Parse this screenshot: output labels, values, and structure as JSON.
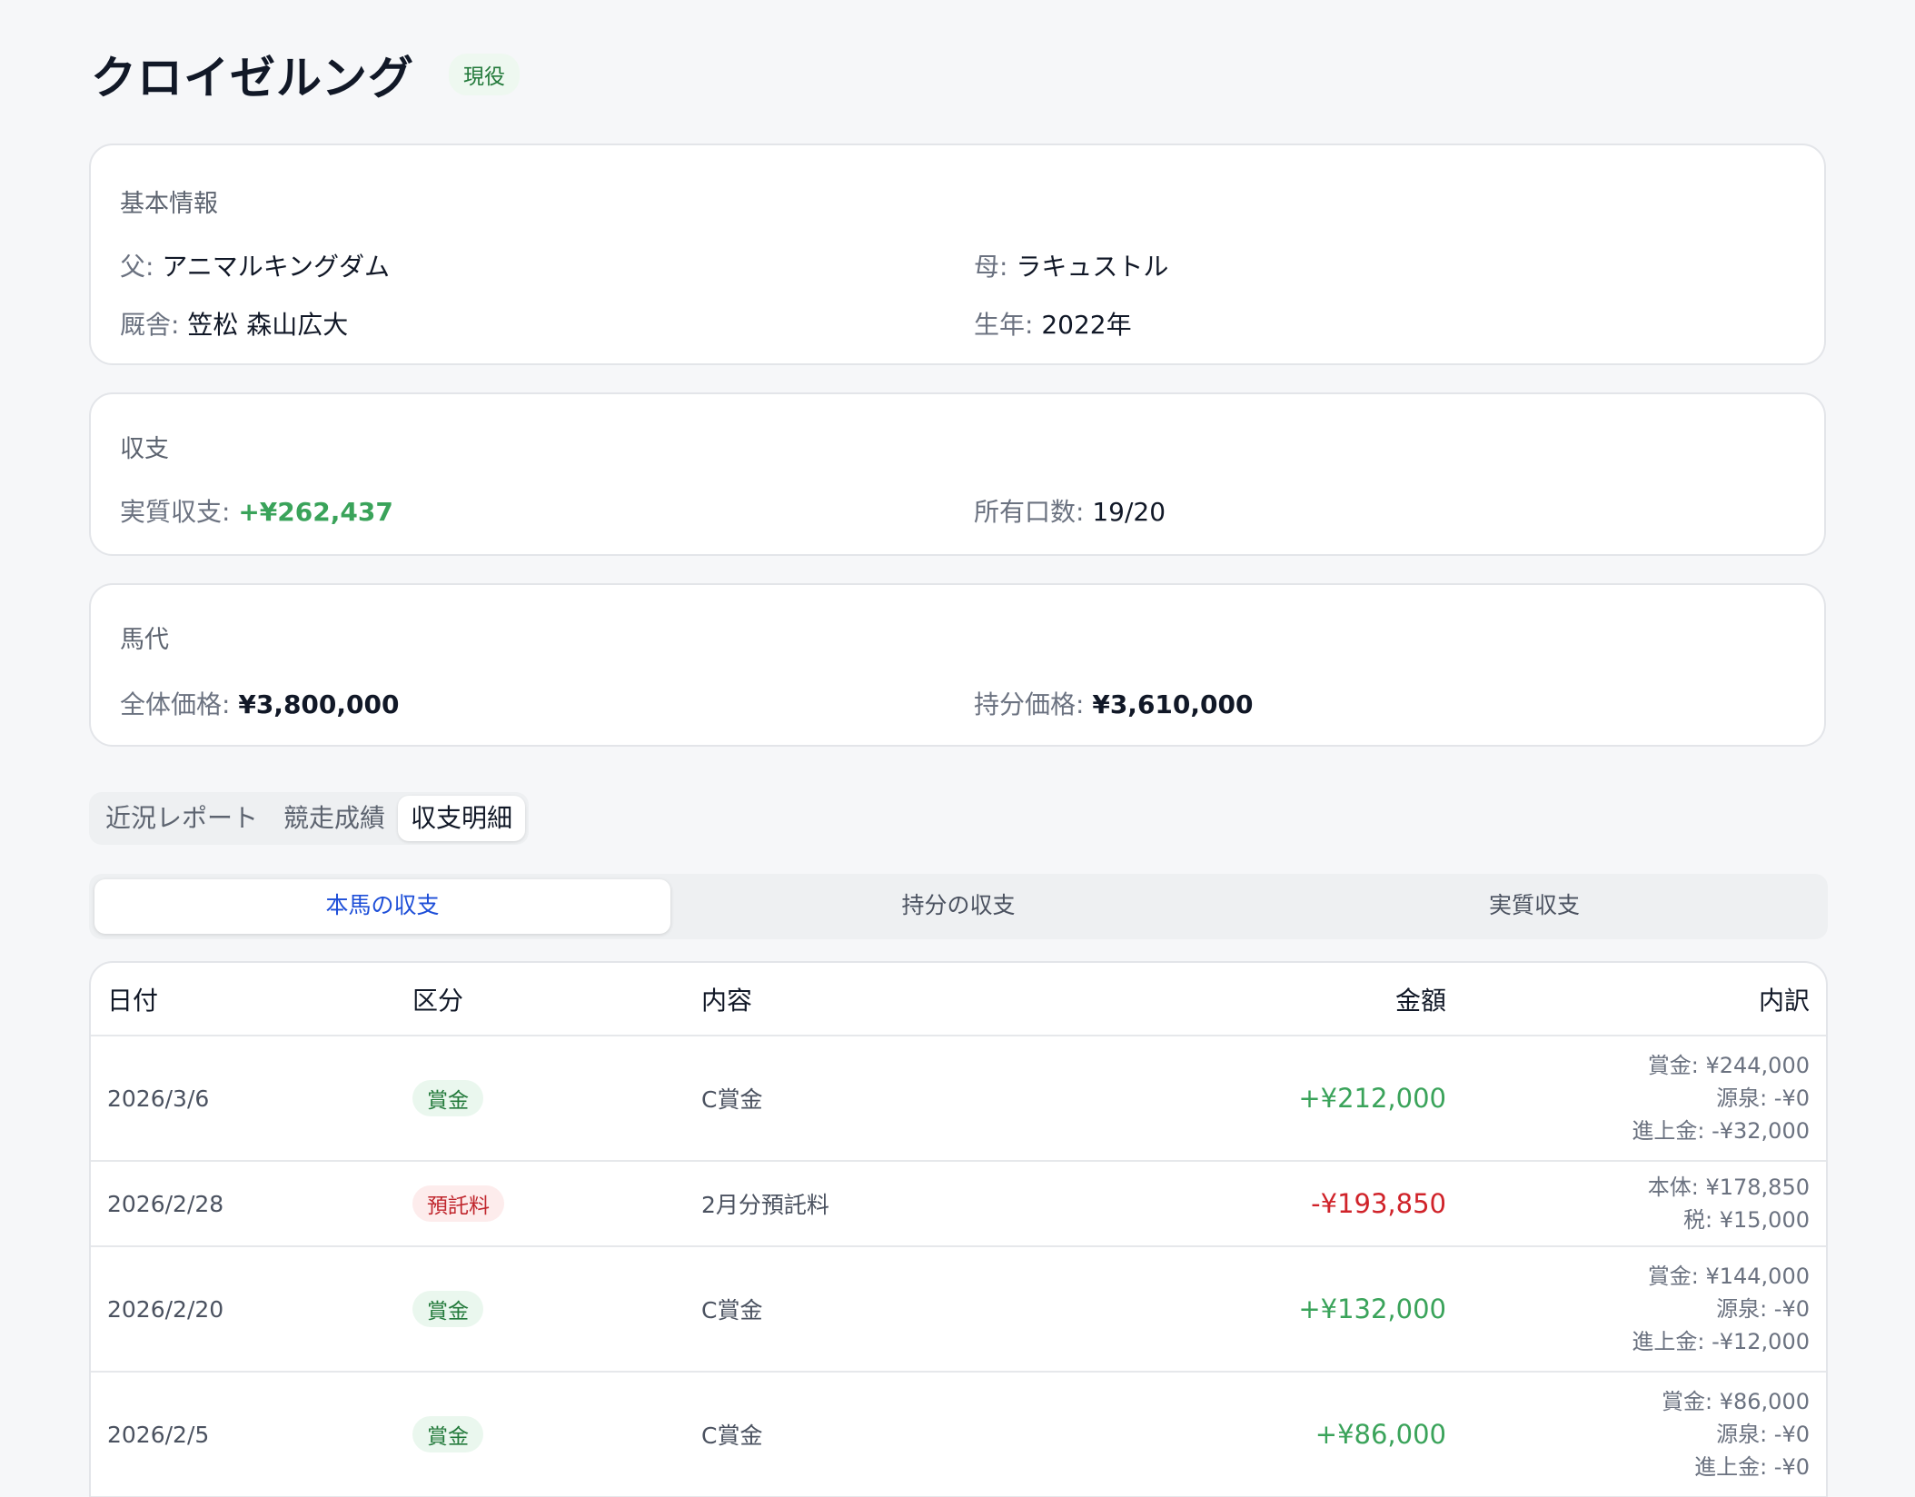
{
  "header": {
    "title": "クロイゼルング",
    "status": "現役"
  },
  "basic_info": {
    "title": "基本情報",
    "sire_label": "父: ",
    "sire": "アニマルキングダム",
    "dam_label": "母: ",
    "dam": "ラキュストル",
    "stable_label": "厩舎: ",
    "stable": "笠松 森山広大",
    "birth_year_label": "生年: ",
    "birth_year": "2022年"
  },
  "income": {
    "title": "収支",
    "net_label": "実質収支: ",
    "net": "+¥262,437",
    "shares_label": "所有口数: ",
    "shares": "19/20"
  },
  "price": {
    "title": "馬代",
    "total_label": "全体価格: ",
    "total": "¥3,800,000",
    "share_label": "持分価格: ",
    "share": "¥3,610,000"
  },
  "tabs": [
    "近況レポート",
    "競走成績",
    "収支明細"
  ],
  "active_tab": 2,
  "segments": [
    "本馬の収支",
    "持分の収支",
    "実質収支"
  ],
  "active_segment": 0,
  "table": {
    "columns": [
      "日付",
      "区分",
      "内容",
      "金額",
      "内訳"
    ],
    "rows": [
      {
        "date": "2026/3/6",
        "category": "賞金",
        "category_type": "prize",
        "content": "C賞金",
        "amount": "+¥212,000",
        "amount_type": "positive",
        "breakdown": [
          "賞金: ¥244,000",
          "源泉: -¥0",
          "進上金: -¥32,000"
        ]
      },
      {
        "date": "2026/2/28",
        "category": "預託料",
        "category_type": "fee",
        "content": "2月分預託料",
        "amount": "-¥193,850",
        "amount_type": "negative",
        "breakdown": [
          "本体: ¥178,850",
          "税: ¥15,000"
        ]
      },
      {
        "date": "2026/2/20",
        "category": "賞金",
        "category_type": "prize",
        "content": "C賞金",
        "amount": "+¥132,000",
        "amount_type": "positive",
        "breakdown": [
          "賞金: ¥144,000",
          "源泉: -¥0",
          "進上金: -¥12,000"
        ]
      },
      {
        "date": "2026/2/5",
        "category": "賞金",
        "category_type": "prize",
        "content": "C賞金",
        "amount": "+¥86,000",
        "amount_type": "positive",
        "breakdown": [
          "賞金: ¥86,000",
          "源泉: -¥0",
          "進上金: -¥0"
        ]
      }
    ]
  }
}
